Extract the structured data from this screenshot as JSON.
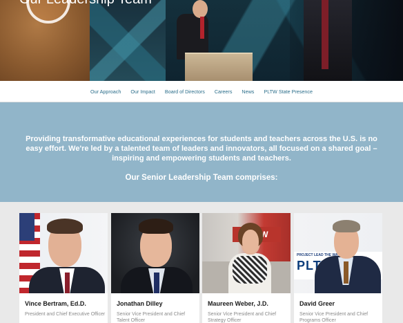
{
  "hero": {
    "title": "Our Leadership Team"
  },
  "nav": {
    "items": [
      "Our Approach",
      "Our Impact",
      "Board of Directors",
      "Careers",
      "News",
      "PLTW State Presence"
    ]
  },
  "intro": {
    "paragraph": "Providing transformative educational experiences for students and teachers across the U.S. is no easy effort. We're led by a talented team of leaders and innovators, all focused on a shared goal – inspiring and empowering students and teachers.",
    "heading": "Our Senior Leadership Team comprises:"
  },
  "team": [
    {
      "name": "Vince Bertram, Ed.D.",
      "title": "President and Chief Executive Officer"
    },
    {
      "name": "Jonathan Dilley",
      "title": "Senior Vice President and Chief Talent Officer"
    },
    {
      "name": "Maureen Weber, J.D.",
      "title": "Senior Vice President and Chief Strategy Officer",
      "sign_text": "PLTW"
    },
    {
      "name": "David Greer",
      "title": "Senior Vice President and Chief Programs Officer",
      "sign_top": "PROJECT LEAD THE WAY",
      "sign_text": "PLTW"
    }
  ],
  "colors": {
    "nav_link": "#2a6d8a",
    "intro_band": "#91b5c9",
    "page_bg": "#e9e9e9"
  }
}
